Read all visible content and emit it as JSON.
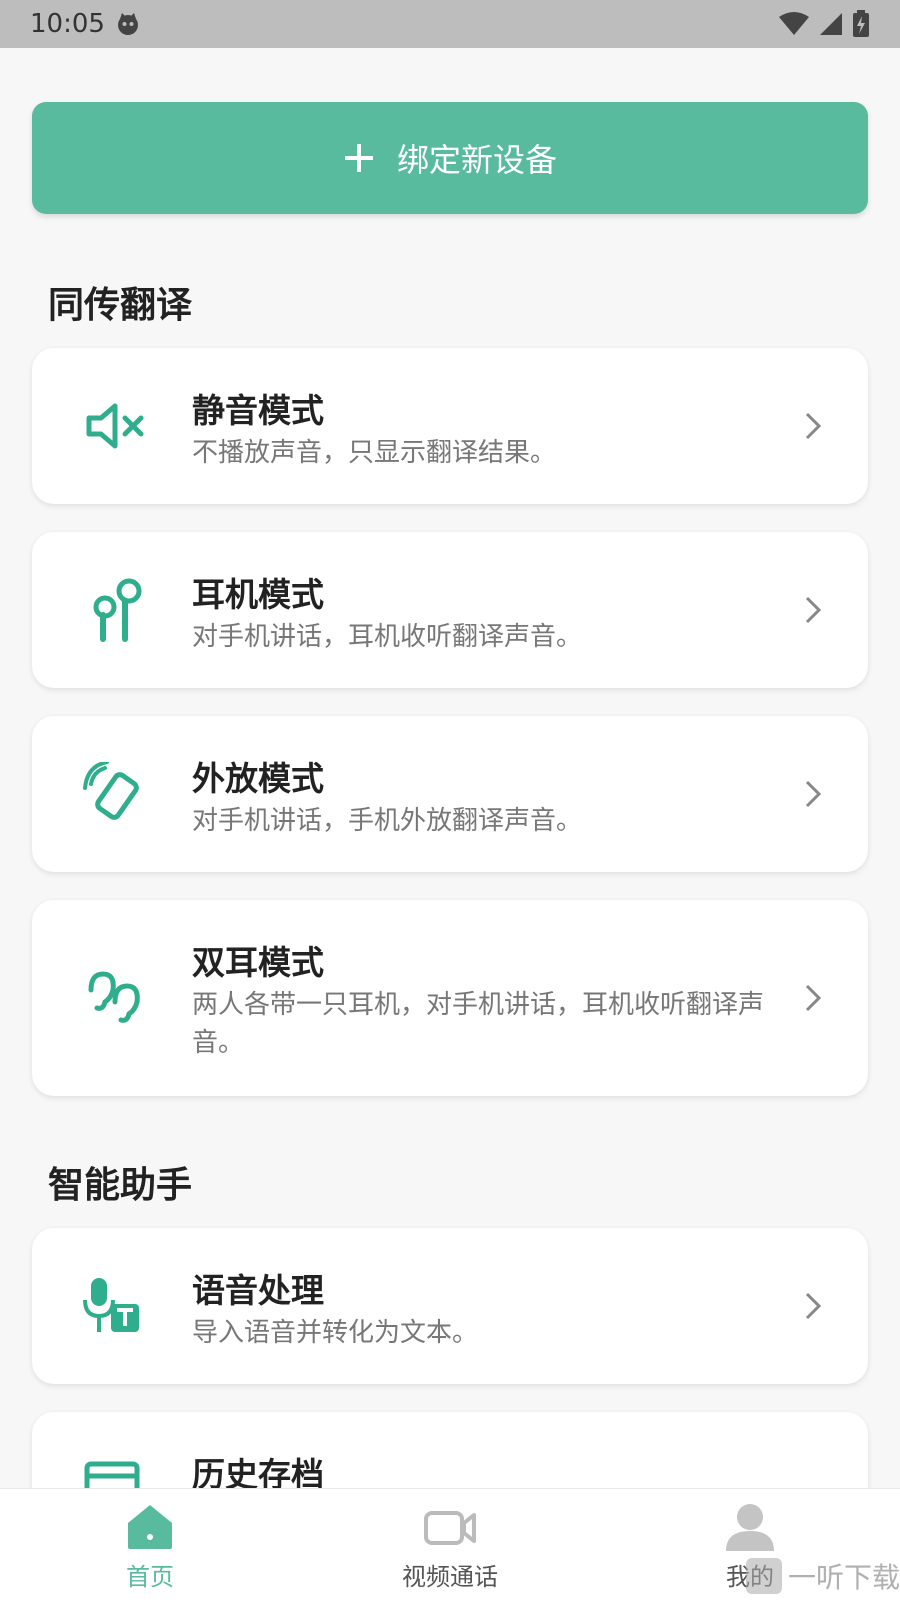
{
  "status_bar": {
    "time": "10:05"
  },
  "bind_button": {
    "label": "绑定新设备"
  },
  "sections": {
    "translation": {
      "title": "同传翻译"
    },
    "assistant": {
      "title": "智能助手"
    }
  },
  "modes": [
    {
      "title": "静音模式",
      "desc": "不播放声音，只显示翻译结果。",
      "icon": "speaker-mute-icon"
    },
    {
      "title": "耳机模式",
      "desc": "对手机讲话，耳机收听翻译声音。",
      "icon": "earbuds-icon"
    },
    {
      "title": "外放模式",
      "desc": "对手机讲话，手机外放翻译声音。",
      "icon": "phone-speaker-icon"
    },
    {
      "title": "双耳模式",
      "desc": "两人各带一只耳机，对手机讲话，耳机收听翻译声音。",
      "icon": "two-ears-icon"
    }
  ],
  "assistant_items": [
    {
      "title": "语音处理",
      "desc": "导入语音并转化为文本。",
      "icon": "voice-to-text-icon"
    },
    {
      "title": "历史存档",
      "icon": "archive-icon"
    }
  ],
  "tabs": [
    {
      "label": "首页",
      "icon": "home-icon",
      "active": true
    },
    {
      "label": "视频通话",
      "icon": "video-camera-icon",
      "active": false
    },
    {
      "label": "我的",
      "icon": "user-icon",
      "active": false
    }
  ],
  "watermark": {
    "text": "一听下载"
  },
  "colors": {
    "accent": "#59bb9e",
    "background": "#f7f7f7",
    "status_bar": "#bdbdbd"
  }
}
